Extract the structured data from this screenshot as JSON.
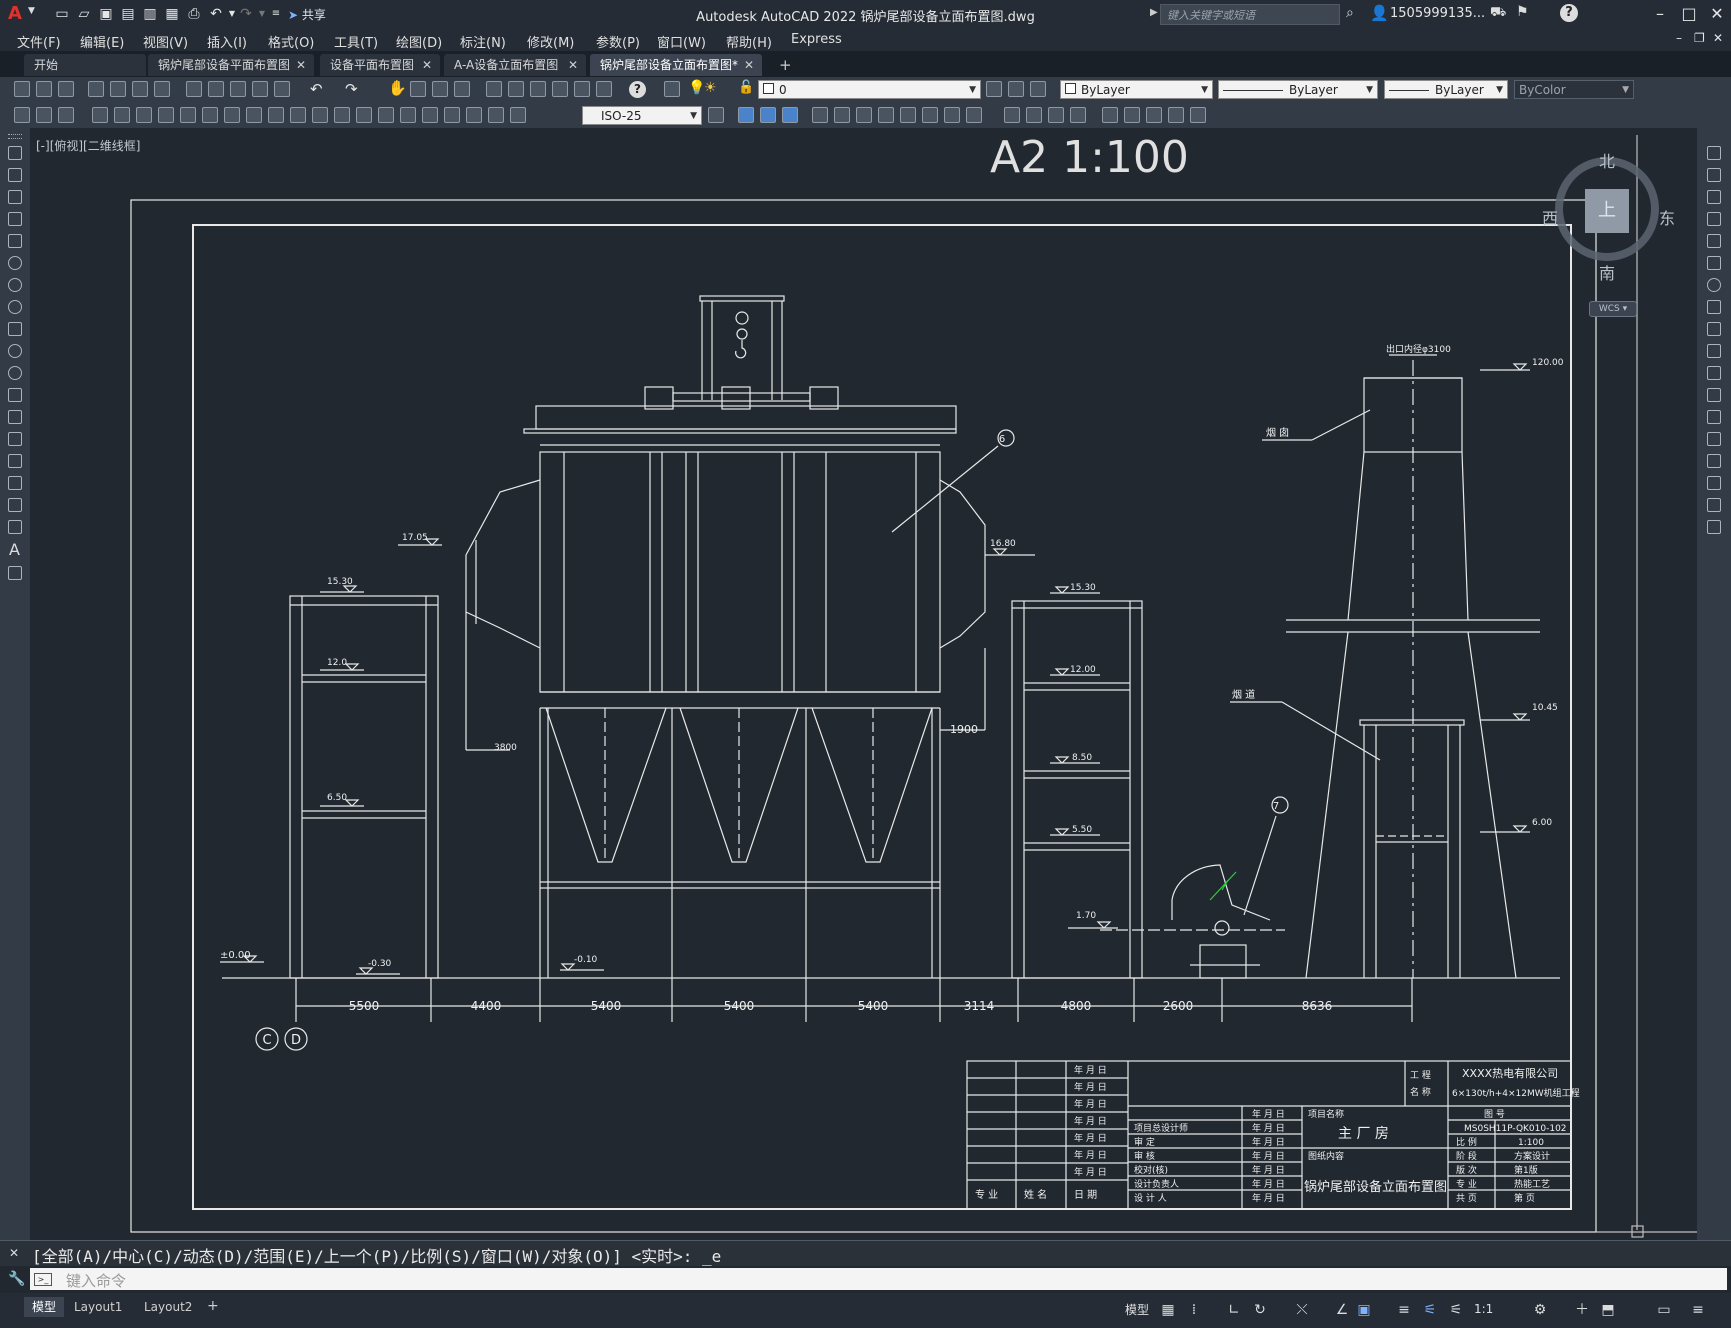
{
  "app": {
    "title": "Autodesk AutoCAD 2022    锅炉尾部设备立面布置图.dwg",
    "search_placeholder": "键入关键字或短语",
    "user": "1505999135...",
    "share_label": "共享"
  },
  "menu": [
    "文件(F)",
    "编辑(E)",
    "视图(V)",
    "插入(I)",
    "格式(O)",
    "工具(T)",
    "绘图(D)",
    "标注(N)",
    "修改(M)",
    "参数(P)",
    "窗口(W)",
    "帮助(H)",
    "Express"
  ],
  "tabs": [
    {
      "label": "开始",
      "active": false
    },
    {
      "label": "锅炉尾部设备平面布置图",
      "active": false
    },
    {
      "label": "设备平面布置图",
      "active": false
    },
    {
      "label": "A-A设备立面布置图",
      "active": false
    },
    {
      "label": "锅炉尾部设备立面布置图*",
      "active": true
    }
  ],
  "toolbar": {
    "layer_value": "0",
    "color_value": "ByLayer",
    "linetype_value": "ByLayer",
    "lineweight_value": "ByLayer",
    "plotstyle_value": "ByColor",
    "dimstyle_value": "ISO-25"
  },
  "viewport_label": "[-][俯视][二维线框]",
  "viewcube": {
    "north": "北",
    "south": "南",
    "east": "东",
    "west": "西",
    "top": "上",
    "wcs": "WCS"
  },
  "drawing": {
    "sheet_title": "A2      1:100",
    "chimney_width": "出口内径φ3100",
    "labels": {
      "chimney": "烟 囱",
      "flue": "烟 道"
    },
    "callouts": [
      "6",
      "7"
    ],
    "elevations": [
      "120.00",
      "17.05",
      "16.80",
      "15.30",
      "15.30",
      "12.0",
      "12.00",
      "8.50",
      "6.50",
      "5.50",
      "1.70",
      "±0.00",
      "-0.30",
      "-0.10",
      "10.45",
      "6.00"
    ],
    "inner_dims": [
      "3800",
      "1900"
    ],
    "bottom_dims": [
      "5500",
      "4400",
      "5400",
      "5400",
      "5400",
      "3114",
      "4800",
      "2600",
      "8636"
    ],
    "axes": [
      "C",
      "D"
    ]
  },
  "title_block": {
    "company": "XXXX热电有限公司",
    "project": "6×130t/h+4×12MW机组工程",
    "project_name_label": "项目名称",
    "project_name": "主  厂  房",
    "drawing_content_label": "图纸内容",
    "drawing_name": "锅炉尾部设备立面布置图",
    "gongcheng": "工  程",
    "mingcheng": "名  称",
    "tuhao_label": "图        号",
    "tuhao": "MS0SH11P-QK010-102",
    "date_cell": "年  月  日",
    "roles": [
      "项目总设计师",
      "审    定",
      "审    核",
      "校对(核)",
      "设计负责人",
      "设 计 人"
    ],
    "left_footer": [
      "专  业",
      "姓  名",
      "日    期"
    ],
    "props": [
      [
        "比  例",
        "1:100"
      ],
      [
        "阶  段",
        "方案设计"
      ],
      [
        "版  次",
        "第1版"
      ],
      [
        "专  业",
        "热能工艺"
      ],
      [
        "共  页",
        "第    页"
      ]
    ]
  },
  "command": {
    "history": "[全部(A)/中心(C)/动态(D)/范围(E)/上一个(P)/比例(S)/窗口(W)/对象(O)] <实时>: _e",
    "placeholder": "键入命令"
  },
  "layouts": [
    {
      "label": "模型",
      "active": true
    },
    {
      "label": "Layout1",
      "active": false
    },
    {
      "label": "Layout2",
      "active": false
    }
  ],
  "status": {
    "model_label": "模型",
    "scale": "1:1"
  }
}
